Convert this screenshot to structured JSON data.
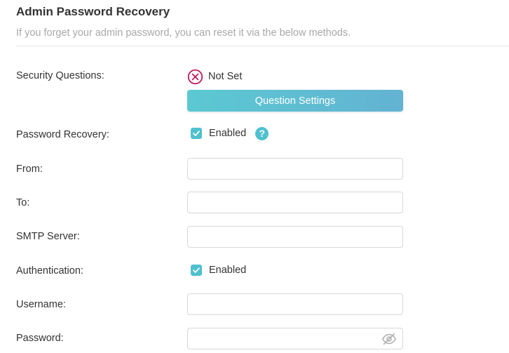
{
  "header": {
    "title": "Admin Password Recovery",
    "subtitle": "If you forget your admin password, you can reset it via the below methods."
  },
  "security_questions": {
    "label": "Security Questions:",
    "status_icon": "x-circle-icon",
    "status": "Not Set",
    "button_label": "Question Settings"
  },
  "password_recovery": {
    "label": "Password Recovery:",
    "checked": true,
    "checkbox_label": "Enabled",
    "help_icon": "help-icon",
    "help_glyph": "?"
  },
  "fields": {
    "from": {
      "label": "From:",
      "value": ""
    },
    "to": {
      "label": "To:",
      "value": ""
    },
    "smtp_server": {
      "label": "SMTP Server:",
      "value": ""
    },
    "username": {
      "label": "Username:",
      "value": ""
    },
    "password": {
      "label": "Password:",
      "value": "",
      "toggle_icon": "eye-off-icon"
    }
  },
  "authentication": {
    "label": "Authentication:",
    "checked": true,
    "checkbox_label": "Enabled"
  },
  "colors": {
    "accent": "#4fc0cf",
    "error": "#c2185b",
    "title": "#333333",
    "muted": "#a8a8a8"
  }
}
